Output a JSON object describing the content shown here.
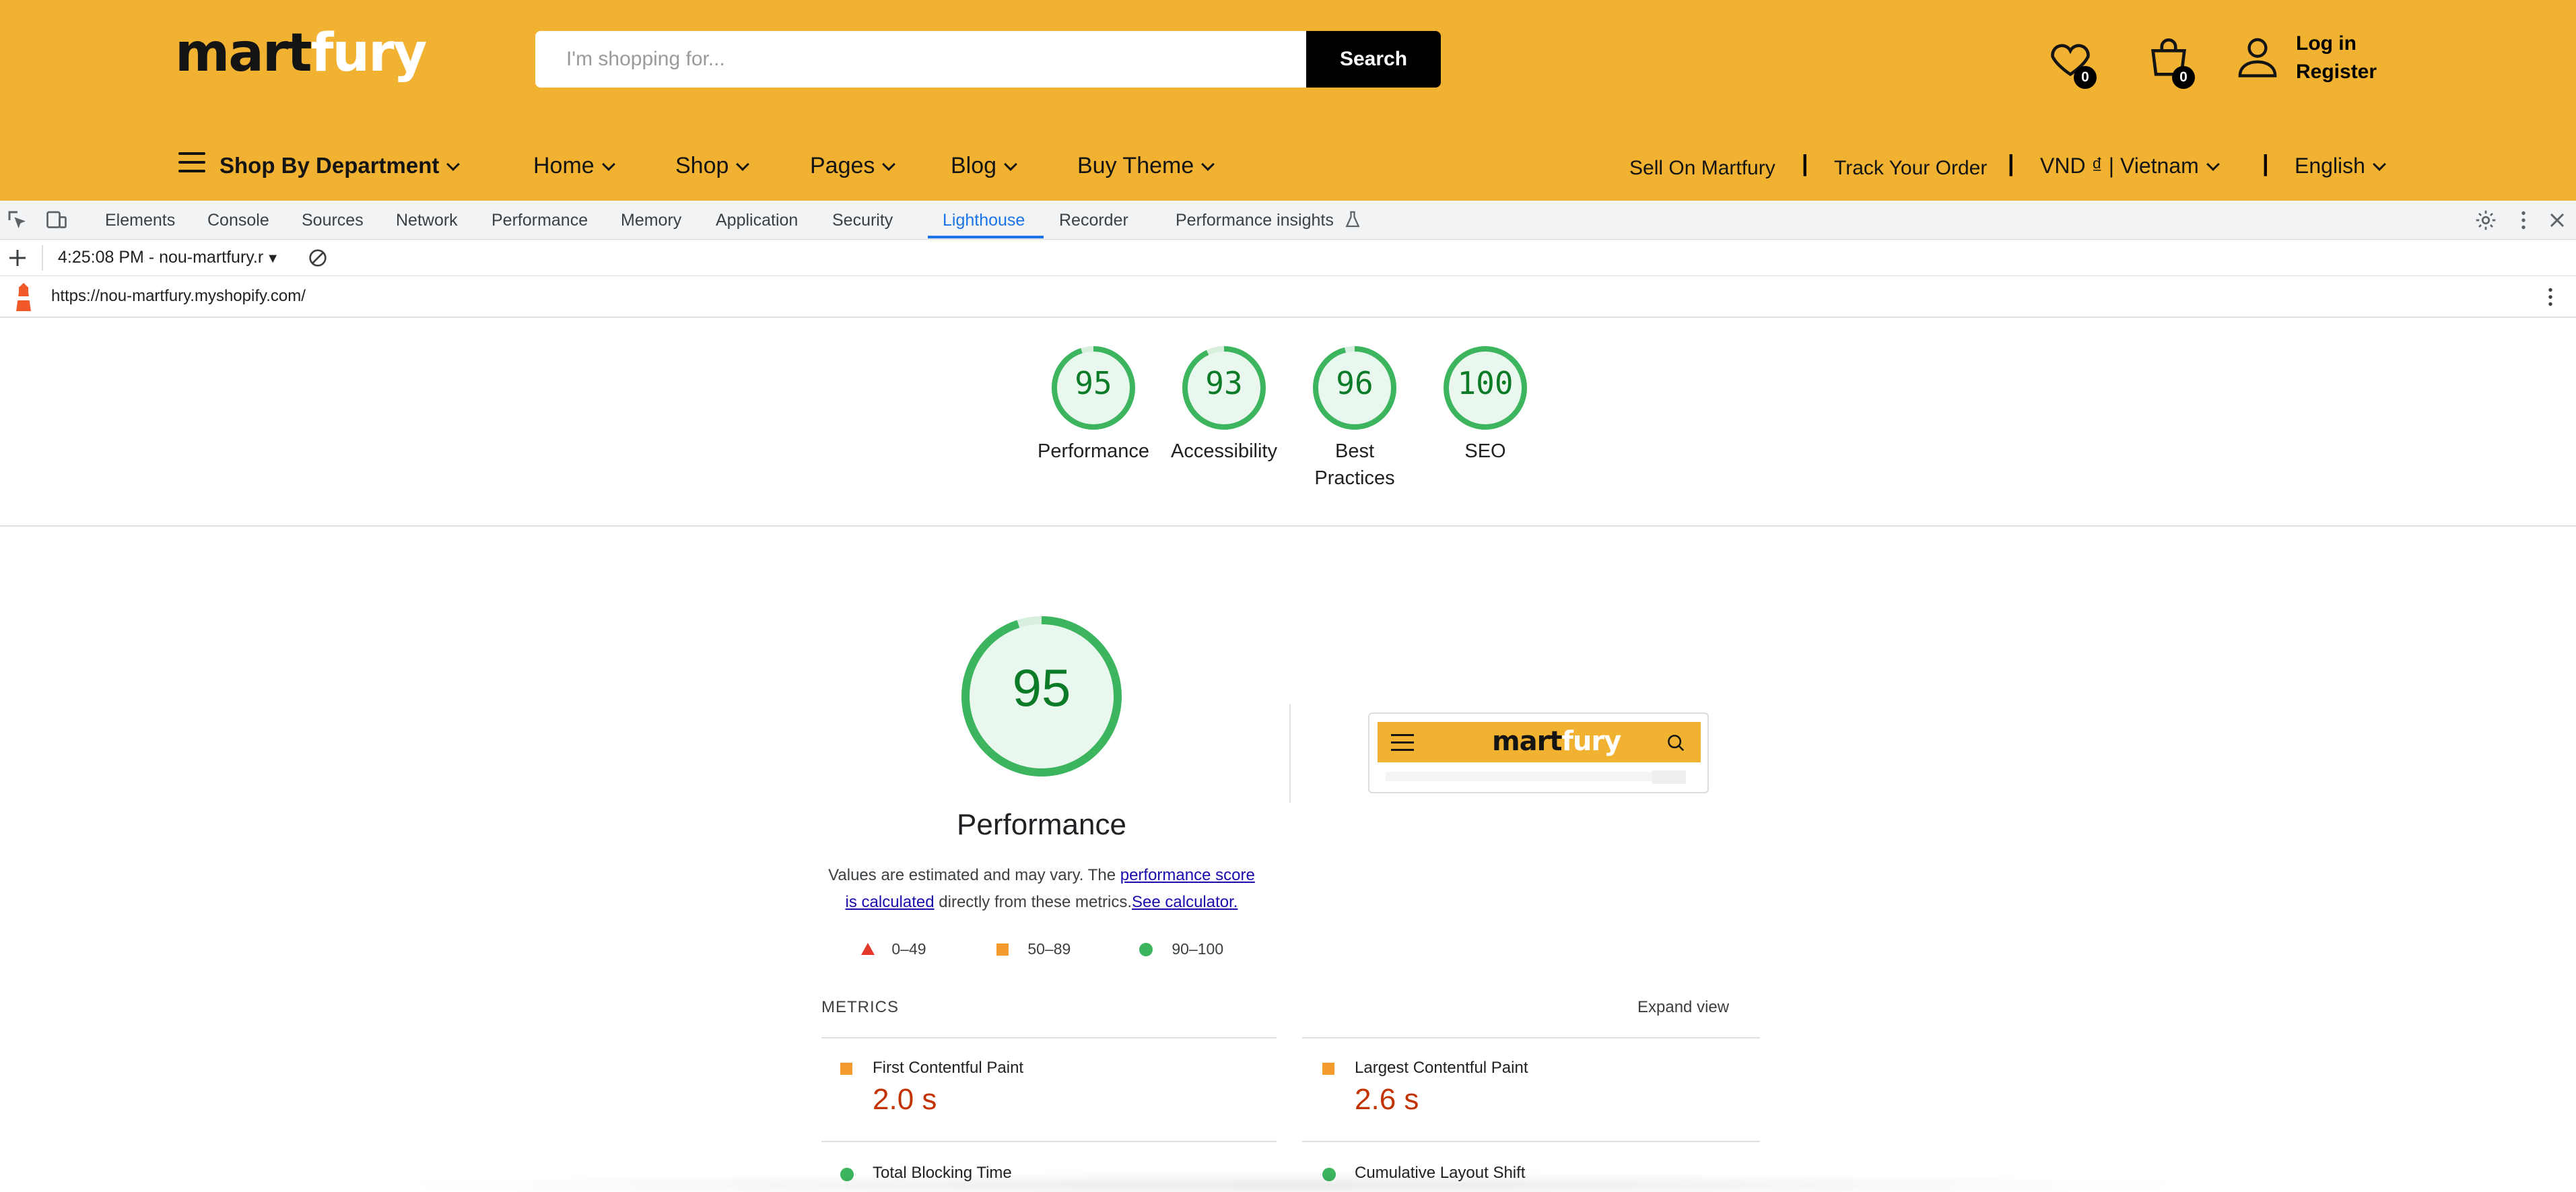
{
  "store": {
    "logo_part1": "mart",
    "logo_part2": "fury",
    "search_placeholder": "I'm shopping for...",
    "search_button": "Search",
    "wishlist_count": "0",
    "cart_count": "0",
    "login": "Log in",
    "register": "Register",
    "brand_color": "#f1b231",
    "nav": {
      "department": "Shop By Department",
      "items": [
        "Home",
        "Shop",
        "Pages",
        "Blog",
        "Buy Theme"
      ],
      "sell": "Sell On Martfury",
      "track": "Track Your Order",
      "currency": "VND ₫ | Vietnam",
      "language": "English",
      "separator": "|"
    }
  },
  "devtools": {
    "tabs": [
      "Elements",
      "Console",
      "Sources",
      "Network",
      "Performance",
      "Memory",
      "Application",
      "Security",
      "Lighthouse",
      "Recorder",
      "Performance insights"
    ],
    "active_tab": "Lighthouse",
    "report_selector": "4:25:08 PM - nou-martfury.r",
    "url": "https://nou-martfury.myshopify.com/"
  },
  "scores": [
    {
      "label": "Performance",
      "value": "95",
      "fraction": 0.95
    },
    {
      "label": "Accessibility",
      "value": "93",
      "fraction": 0.93
    },
    {
      "label": "Best",
      "label2": "Practices",
      "value": "96",
      "fraction": 0.96
    },
    {
      "label": "SEO",
      "value": "100",
      "fraction": 1.0
    }
  ],
  "performance": {
    "score": "95",
    "fraction": 0.95,
    "title": "Performance",
    "desc_1": "Values are estimated and may vary. The ",
    "desc_link1": "performance score is calculated",
    "desc_2": " directly from these metrics.",
    "desc_link2": "See calculator.",
    "legend": [
      "0–49",
      "50–89",
      "90–100"
    ]
  },
  "metrics": {
    "heading": "METRICS",
    "expand": "Expand view",
    "items": [
      {
        "title": "First Contentful Paint",
        "value": "2.0 s"
      },
      {
        "title": "Largest Contentful Paint",
        "value": "2.6 s"
      },
      {
        "title": "Total Blocking Time",
        "value": ""
      },
      {
        "title": "Cumulative Layout Shift",
        "value": ""
      }
    ]
  },
  "colors": {
    "pass": "#3cb55e",
    "average": "#f39b2c",
    "fail": "#e5382d",
    "pass_text": "#0c7b27",
    "average_text": "#c33300"
  }
}
